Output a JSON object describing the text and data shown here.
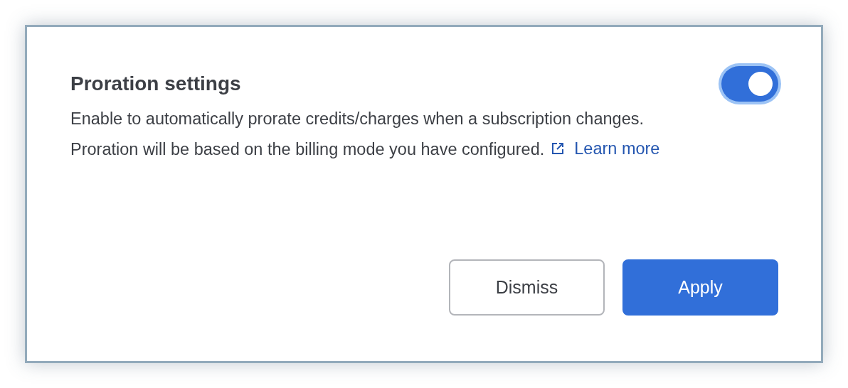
{
  "title": "Proration settings",
  "toggle": {
    "on": true
  },
  "description": "Enable to automatically prorate credits/charges when a subscription changes. Proration will be based on the billing mode you have configured.",
  "link": "Learn more",
  "buttons": [
    {
      "label": "Dismiss",
      "kind": "secondary"
    },
    {
      "label": "Apply",
      "kind": "primary"
    }
  ]
}
